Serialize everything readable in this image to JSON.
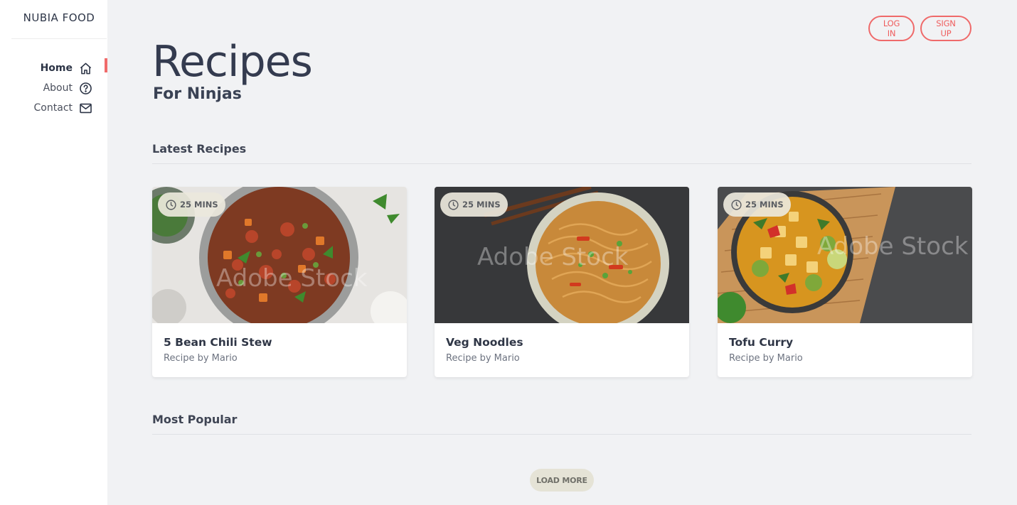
{
  "brand": "NUBIA FOOD",
  "nav": [
    {
      "label": "Home",
      "icon": "home-icon",
      "active": true
    },
    {
      "label": "About",
      "icon": "question-circle-icon",
      "active": false
    },
    {
      "label": "Contact",
      "icon": "envelope-icon",
      "active": false
    }
  ],
  "auth": {
    "login_label": "LOG IN",
    "signup_label": "SIGN UP"
  },
  "header": {
    "title": "Recipes",
    "subtitle": "For Ninjas"
  },
  "sections": {
    "latest": "Latest Recipes",
    "popular": "Most Popular"
  },
  "recipes": [
    {
      "title": "5 Bean Chili Stew",
      "author": "Recipe by Mario",
      "time": "25 MINS",
      "watermark": "Adobe Stock"
    },
    {
      "title": "Veg Noodles",
      "author": "Recipe by Mario",
      "time": "25 MINS",
      "watermark": "Adobe Stock"
    },
    {
      "title": "Tofu Curry",
      "author": "Recipe by Mario",
      "time": "25 MINS",
      "watermark": "Adobe Stock"
    }
  ],
  "load_more_label": "LOAD MORE",
  "colors": {
    "accent": "#ef6a6a",
    "background": "#f1f2f4",
    "sidebar": "#ffffff",
    "badge": "#ece8dc"
  }
}
